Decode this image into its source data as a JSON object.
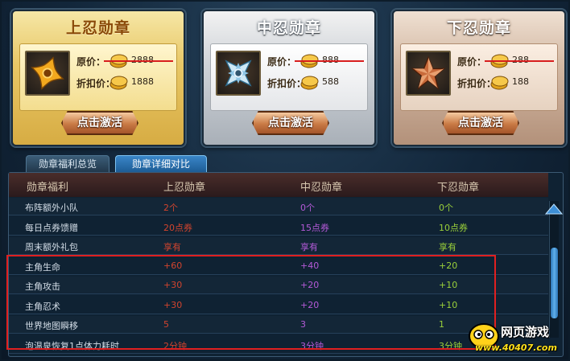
{
  "cards": [
    {
      "title": "上忍勋章",
      "orig_label": "原价：",
      "orig_price": "2888",
      "disc_label": "折扣价：",
      "disc_price": "1888",
      "button": "点击激活",
      "medal_icon": "golden-shuriken-icon"
    },
    {
      "title": "中忍勋章",
      "orig_label": "原价：",
      "orig_price": "888",
      "disc_label": "折扣价：",
      "disc_price": "588",
      "button": "点击激活",
      "medal_icon": "silver-shuriken-icon"
    },
    {
      "title": "下忍勋章",
      "orig_label": "原价：",
      "orig_price": "288",
      "disc_label": "折扣价：",
      "disc_price": "188",
      "button": "点击激活",
      "medal_icon": "bronze-star-icon"
    }
  ],
  "tabs": [
    {
      "label": "勋章福利总览",
      "active": false
    },
    {
      "label": "勋章详细对比",
      "active": true
    }
  ],
  "table": {
    "headers": [
      "勋章福利",
      "上忍勋章",
      "中忍勋章",
      "下忍勋章"
    ],
    "rows": [
      [
        "布阵额外小队",
        "2个",
        "0个",
        "0个"
      ],
      [
        "每日点券馈赠",
        "20点券",
        "15点券",
        "10点券"
      ],
      [
        "周末额外礼包",
        "享有",
        "享有",
        "享有"
      ],
      [
        "主角生命",
        "+60",
        "+40",
        "+20"
      ],
      [
        "主角攻击",
        "+30",
        "+20",
        "+10"
      ],
      [
        "主角忍术",
        "+30",
        "+20",
        "+10"
      ],
      [
        "世界地图瞬移",
        "5",
        "3",
        "1"
      ],
      [
        "泡温泉恢复1点体力耗时",
        "2分钟",
        "3分钟",
        "3分钟"
      ]
    ]
  },
  "watermark": {
    "title": "网页游戏",
    "url": "www.40407.com"
  },
  "colors": {
    "upper": "#d2442e",
    "middle": "#b45ad8",
    "lower": "#9ad03a",
    "highlight": "#e02020"
  }
}
